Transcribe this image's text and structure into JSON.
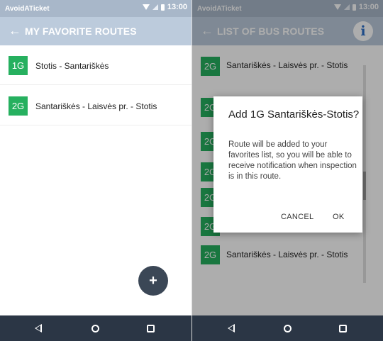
{
  "status_bar": {
    "app_name": "AvoidATicket",
    "time": "13:00"
  },
  "favorites_screen": {
    "title": "MY FAVORITE ROUTES",
    "routes": [
      {
        "badge": "1G",
        "label": "Stotis - Santariškės"
      },
      {
        "badge": "2G",
        "label": "Santariškės - Laisvės pr. - Stotis"
      }
    ],
    "fab_label": "+"
  },
  "bus_routes_screen": {
    "title": "LIST OF BUS ROUTES",
    "info_icon_label": "i",
    "routes": [
      {
        "badge": "2G",
        "label": "Santariškės - Laisvės pr. - Stotis"
      },
      {
        "badge": "2G",
        "label": ""
      },
      {
        "badge": "2G",
        "label": ""
      },
      {
        "badge": "2G",
        "label": ""
      },
      {
        "badge": "2G",
        "label": ""
      },
      {
        "badge": "2G",
        "label": ""
      },
      {
        "badge": "2G",
        "label": "Santariškės - Laisvės pr. - Stotis"
      }
    ]
  },
  "dialog": {
    "title": "Add 1G Santariškės-Stotis?",
    "body": "Route will be added to your favorites list, so you will be able to receive notification when inspection is in this route.",
    "cancel_label": "CANCEL",
    "ok_label": "OK"
  },
  "icons": {
    "back": "arrow-left-icon",
    "info": "info-icon",
    "nav_back": "triangle-back-icon",
    "nav_home": "circle-home-icon",
    "nav_recent": "square-recent-icon",
    "wifi": "wifi-icon",
    "signal": "signal-icon",
    "battery": "battery-icon"
  },
  "colors": {
    "app_bar": "#bccbdc",
    "status_bar": "#a8b7c9",
    "badge": "#26b05f",
    "fab": "#3b4756",
    "nav_bar": "#2b3645",
    "info_icon": "#2f71c9"
  }
}
